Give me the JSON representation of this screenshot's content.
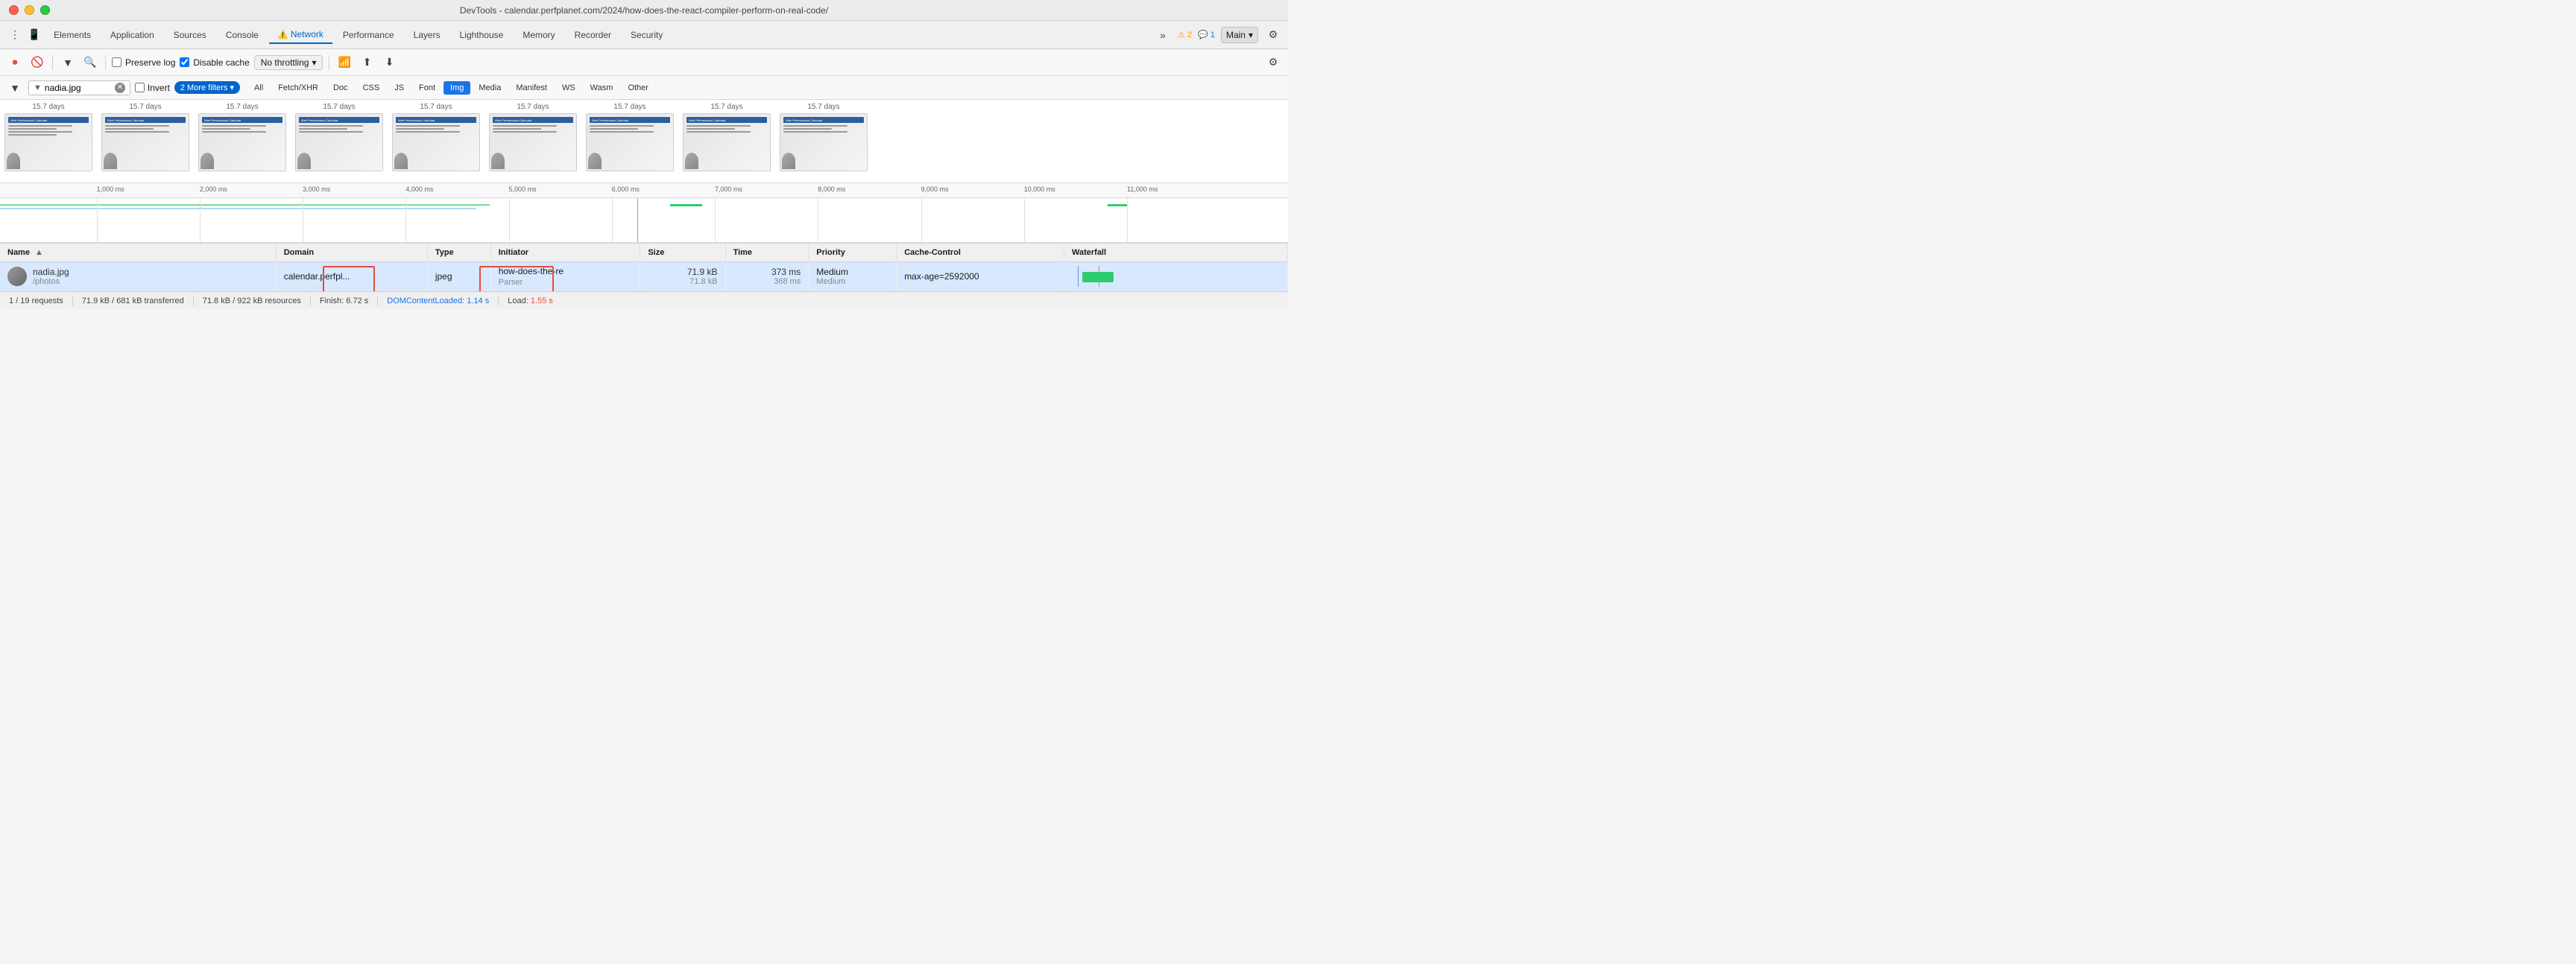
{
  "titleBar": {
    "title": "DevTools - calendar.perfplanet.com/2024/how-does-the-react-compiler-perform-on-real-code/"
  },
  "tabs": {
    "items": [
      {
        "id": "inspector",
        "label": "Elements",
        "icon": ""
      },
      {
        "id": "application",
        "label": "Application",
        "icon": ""
      },
      {
        "id": "sources",
        "label": "Sources",
        "icon": ""
      },
      {
        "id": "console",
        "label": "Console",
        "icon": ""
      },
      {
        "id": "network",
        "label": "Network",
        "icon": "⚠️",
        "active": true
      },
      {
        "id": "performance",
        "label": "Performance",
        "icon": ""
      },
      {
        "id": "layers",
        "label": "Layers",
        "icon": ""
      },
      {
        "id": "lighthouse",
        "label": "Lighthouse",
        "icon": ""
      },
      {
        "id": "memory",
        "label": "Memory",
        "icon": ""
      },
      {
        "id": "recorder",
        "label": "Recorder",
        "icon": ""
      },
      {
        "id": "security",
        "label": "Security",
        "icon": ""
      }
    ],
    "more_label": "»",
    "warning_badge": "2",
    "chat_badge": "1",
    "main_label": "Main",
    "settings_icon": "⚙"
  },
  "toolbar": {
    "record_icon": "⏺",
    "clear_icon": "🚫",
    "filter_icon": "🔽",
    "search_icon": "🔍",
    "preserve_log_label": "Preserve log",
    "disable_cache_label": "Disable cache",
    "throttle_label": "No throttling",
    "throttle_icon": "▾",
    "wifi_icon": "📶",
    "upload_icon": "⬆",
    "download_icon": "⬇",
    "settings_icon": "⚙"
  },
  "filterBar": {
    "filter_icon": "🔽",
    "filter_value": "nadia.jpg",
    "invert_label": "Invert",
    "more_filters_count": "2",
    "more_filters_label": "More filters",
    "types": [
      {
        "id": "all",
        "label": "All"
      },
      {
        "id": "fetch-xhr",
        "label": "Fetch/XHR"
      },
      {
        "id": "doc",
        "label": "Doc"
      },
      {
        "id": "css",
        "label": "CSS"
      },
      {
        "id": "js",
        "label": "JS"
      },
      {
        "id": "font",
        "label": "Font"
      },
      {
        "id": "img",
        "label": "Img",
        "active": true
      },
      {
        "id": "media",
        "label": "Media"
      },
      {
        "id": "manifest",
        "label": "Manifest"
      },
      {
        "id": "ws",
        "label": "WS"
      },
      {
        "id": "wasm",
        "label": "Wasm"
      },
      {
        "id": "other",
        "label": "Other"
      }
    ]
  },
  "filmstrip": {
    "frames": [
      {
        "time": "15.7 days"
      },
      {
        "time": "15.7 days"
      },
      {
        "time": "15.7 days"
      },
      {
        "time": "15.7 days"
      },
      {
        "time": "15.7 days"
      },
      {
        "time": "15.7 days"
      },
      {
        "time": "15.7 days"
      },
      {
        "time": "15.7 days"
      },
      {
        "time": "15.7 days"
      }
    ]
  },
  "ruler": {
    "ticks": [
      {
        "label": "1,000 ms",
        "pos_pct": 7.5
      },
      {
        "label": "2,000 ms",
        "pos_pct": 15.5
      },
      {
        "label": "3,000 ms",
        "pos_pct": 23.5
      },
      {
        "label": "4,000 ms",
        "pos_pct": 31.5
      },
      {
        "label": "5,000 ms",
        "pos_pct": 39.5
      },
      {
        "label": "6,000 ms",
        "pos_pct": 47.5
      },
      {
        "label": "7,000 ms",
        "pos_pct": 55.5
      },
      {
        "label": "8,000 ms",
        "pos_pct": 63.5
      },
      {
        "label": "9,000 ms",
        "pos_pct": 71.5
      },
      {
        "label": "10,000 ms",
        "pos_pct": 79.5
      },
      {
        "label": "11,000 ms",
        "pos_pct": 87.5
      }
    ]
  },
  "tableHeaders": [
    {
      "id": "name",
      "label": "Name"
    },
    {
      "id": "domain",
      "label": "Domain"
    },
    {
      "id": "type",
      "label": "Type"
    },
    {
      "id": "initiator",
      "label": "Initiator"
    },
    {
      "id": "size",
      "label": "Size"
    },
    {
      "id": "time",
      "label": "Time"
    },
    {
      "id": "priority",
      "label": "Priority"
    },
    {
      "id": "cache-control",
      "label": "Cache-Control"
    },
    {
      "id": "waterfall",
      "label": "Waterfall"
    }
  ],
  "tableRows": [
    {
      "name": "nadia.jpg",
      "path": "/photos",
      "domain": "calendar.perfpl...",
      "type": "jpeg",
      "initiator": "how-does-the-re",
      "initiator2": "Parser",
      "size_primary": "71.9 kB",
      "size_secondary": "71.8 kB",
      "time_primary": "373 ms",
      "time_secondary": "368 ms",
      "priority": "Medium",
      "priority2": "Medium",
      "cache_control": "max-age=2592000",
      "selected": true
    }
  ],
  "highlights": {
    "type_box": {
      "label": "Type highlight"
    },
    "size_box": {
      "label": "Size highlight"
    }
  },
  "statusBar": {
    "requests": "1 / 19 requests",
    "transferred": "71.9 kB / 681 kB transferred",
    "resources": "71.8 kB / 922 kB resources",
    "finish": "Finish: 6.72 s",
    "dom_loaded_label": "DOMContentLoaded:",
    "dom_loaded_value": "1.14 s",
    "load_label": "Load:",
    "load_value": "1.55 s"
  },
  "colors": {
    "accent_blue": "#1a73e8",
    "accent_red": "#e74c3c",
    "accent_green": "#2ecc71",
    "tab_active": "#0066cc",
    "highlight_red": "#e74c3c"
  }
}
